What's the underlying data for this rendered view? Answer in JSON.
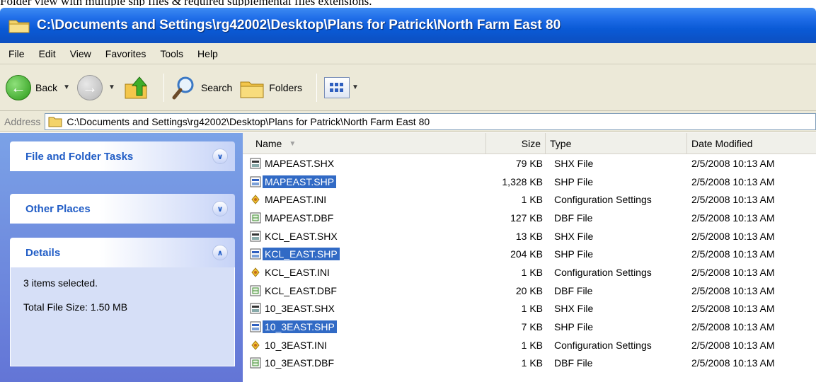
{
  "caption": "Folder view with multiple shp files & required supplemental files extensions.",
  "window": {
    "title": "C:\\Documents and Settings\\rg42002\\Desktop\\Plans for Patrick\\North Farm East 80"
  },
  "menu": [
    "File",
    "Edit",
    "View",
    "Favorites",
    "Tools",
    "Help"
  ],
  "toolbar": {
    "back_label": "Back",
    "search_label": "Search",
    "folders_label": "Folders"
  },
  "address": {
    "label": "Address",
    "value": "C:\\Documents and Settings\\rg42002\\Desktop\\Plans for Patrick\\North Farm East 80"
  },
  "tasks": {
    "file_folder_tasks": "File and Folder Tasks",
    "other_places": "Other Places",
    "details": "Details",
    "details_selected": "3 items selected.",
    "details_size": "Total File Size: 1.50 MB"
  },
  "columns": {
    "name": "Name",
    "size": "Size",
    "type": "Type",
    "date": "Date Modified"
  },
  "files": [
    {
      "name": "MAPEAST.SHX",
      "size": "79 KB",
      "type": "SHX File",
      "date": "2/5/2008 10:13 AM",
      "icon": "shx-file-icon",
      "selected": false
    },
    {
      "name": "MAPEAST.SHP",
      "size": "1,328 KB",
      "type": "SHP File",
      "date": "2/5/2008 10:13 AM",
      "icon": "shp-file-icon",
      "selected": true
    },
    {
      "name": "MAPEAST.INI",
      "size": "1 KB",
      "type": "Configuration Settings",
      "date": "2/5/2008 10:13 AM",
      "icon": "config-file-icon",
      "selected": false
    },
    {
      "name": "MAPEAST.DBF",
      "size": "127 KB",
      "type": "DBF File",
      "date": "2/5/2008 10:13 AM",
      "icon": "dbf-file-icon",
      "selected": false
    },
    {
      "name": "KCL_EAST.SHX",
      "size": "13 KB",
      "type": "SHX File",
      "date": "2/5/2008 10:13 AM",
      "icon": "shx-file-icon",
      "selected": false
    },
    {
      "name": "KCL_EAST.SHP",
      "size": "204 KB",
      "type": "SHP File",
      "date": "2/5/2008 10:13 AM",
      "icon": "shp-file-icon",
      "selected": true
    },
    {
      "name": "KCL_EAST.INI",
      "size": "1 KB",
      "type": "Configuration Settings",
      "date": "2/5/2008 10:13 AM",
      "icon": "config-file-icon",
      "selected": false
    },
    {
      "name": "KCL_EAST.DBF",
      "size": "20 KB",
      "type": "DBF File",
      "date": "2/5/2008 10:13 AM",
      "icon": "dbf-file-icon",
      "selected": false
    },
    {
      "name": "10_3EAST.SHX",
      "size": "1 KB",
      "type": "SHX File",
      "date": "2/5/2008 10:13 AM",
      "icon": "shx-file-icon",
      "selected": false
    },
    {
      "name": "10_3EAST.SHP",
      "size": "7 KB",
      "type": "SHP File",
      "date": "2/5/2008 10:13 AM",
      "icon": "shp-file-icon",
      "selected": true
    },
    {
      "name": "10_3EAST.INI",
      "size": "1 KB",
      "type": "Configuration Settings",
      "date": "2/5/2008 10:13 AM",
      "icon": "config-file-icon",
      "selected": false
    },
    {
      "name": "10_3EAST.DBF",
      "size": "1 KB",
      "type": "DBF File",
      "date": "2/5/2008 10:13 AM",
      "icon": "dbf-file-icon",
      "selected": false
    }
  ],
  "colors": {
    "titlebar": "#0a5ad6",
    "selection": "#316ac5",
    "taskpane": "#6f8fe0",
    "task_title": "#215dc6",
    "chrome": "#ece9d8"
  }
}
